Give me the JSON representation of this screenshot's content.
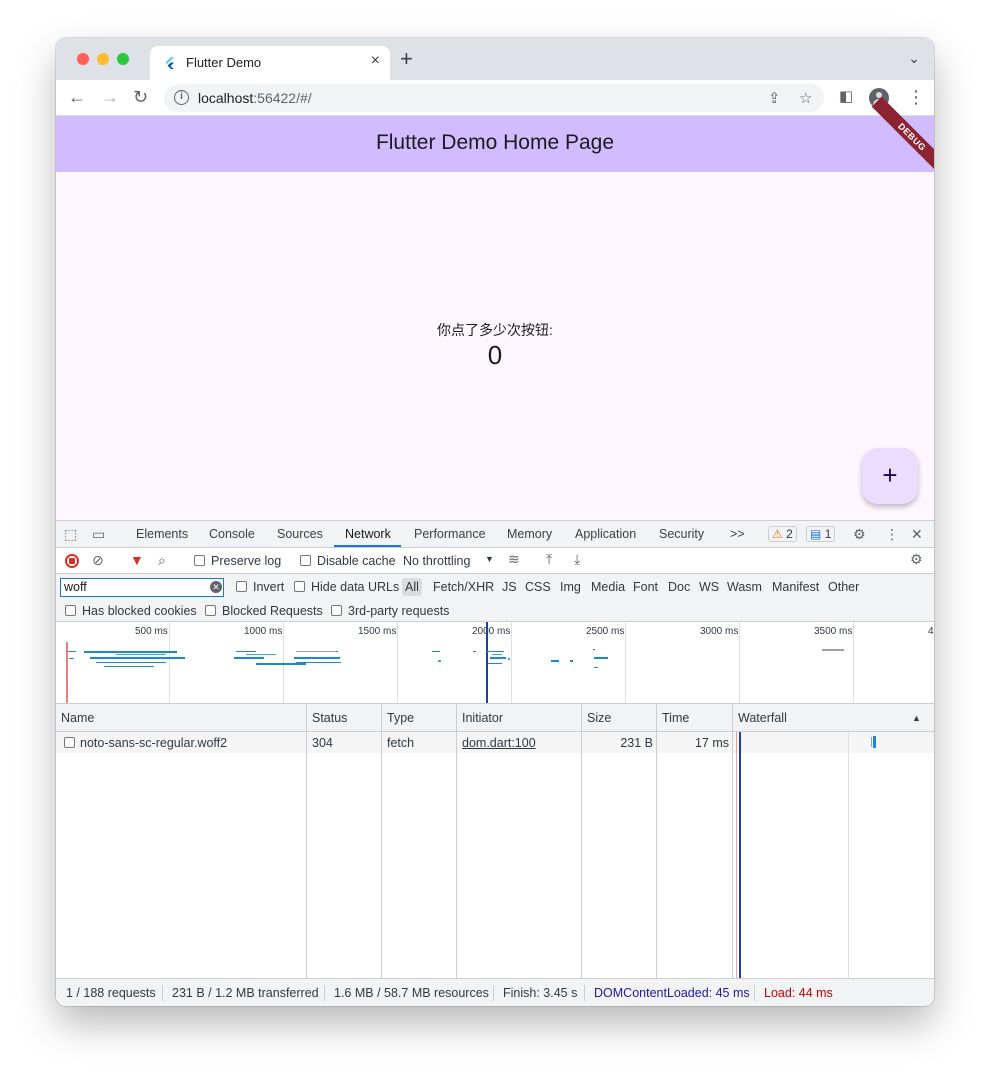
{
  "browser": {
    "tab_title": "Flutter Demo",
    "url_host": "localhost",
    "url_rest": ":56422/#/"
  },
  "app": {
    "title": "Flutter Demo Home Page",
    "debug_banner": "DEBUG",
    "counter_label": "你点了多少次按钮:",
    "counter_value": "0",
    "fab_label": "+"
  },
  "devtools": {
    "tabs": [
      "Elements",
      "Console",
      "Sources",
      "Network",
      "Performance",
      "Memory",
      "Application",
      "Security"
    ],
    "more_tabs": ">>",
    "warnings_count": "2",
    "messages_count": "1",
    "preserve_log": "Preserve log",
    "disable_cache": "Disable cache",
    "throttling": "No throttling",
    "filter_value": "woff",
    "invert": "Invert",
    "hide_data_urls": "Hide data URLs",
    "type_filters": [
      "All",
      "Fetch/XHR",
      "JS",
      "CSS",
      "Img",
      "Media",
      "Font",
      "Doc",
      "WS",
      "Wasm",
      "Manifest",
      "Other"
    ],
    "has_blocked_cookies": "Has blocked cookies",
    "blocked_requests": "Blocked Requests",
    "third_party": "3rd-party requests",
    "timeline_labels": [
      "500 ms",
      "1000 ms",
      "1500 ms",
      "2000 ms",
      "2500 ms",
      "3000 ms",
      "3500 ms",
      "4"
    ],
    "columns": [
      "Name",
      "Status",
      "Type",
      "Initiator",
      "Size",
      "Time",
      "Waterfall"
    ],
    "rows": [
      {
        "name": "noto-sans-sc-regular.woff2",
        "status": "304",
        "type": "fetch",
        "initiator": "dom.dart:100",
        "size": "231 B",
        "time": "17 ms"
      }
    ],
    "status_bar": {
      "requests": "1 / 188 requests",
      "transferred": "231 B / 1.2 MB transferred",
      "resources": "1.6 MB / 58.7 MB resources",
      "finish": "Finish: 3.45 s",
      "dom_loaded": "DOMContentLoaded: 45 ms",
      "load": "Load: 44 ms"
    }
  },
  "colors": {
    "appbar": "#d0bcff",
    "accent": "#1a73e8",
    "dom_loaded": "#1a1aa6",
    "load": "#c80000"
  }
}
